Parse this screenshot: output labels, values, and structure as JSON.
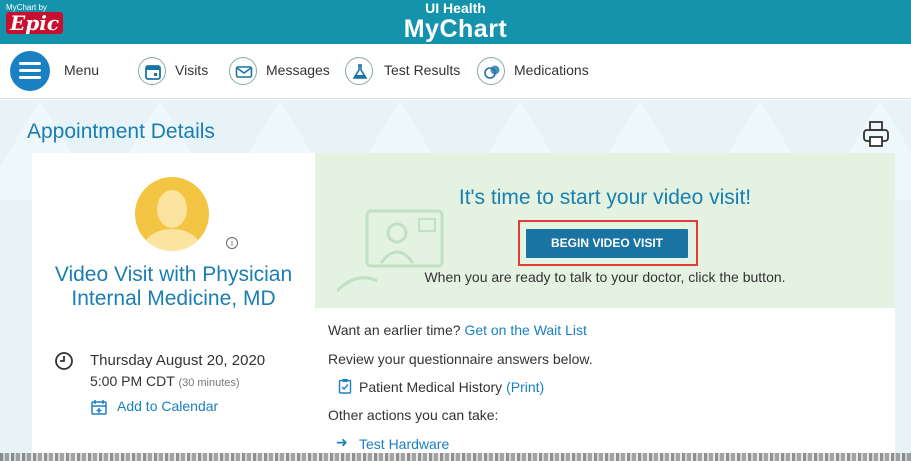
{
  "header": {
    "epic_small": "MyChart by",
    "epic_logo": "Epic",
    "brand_line1": "UI Health",
    "brand_line2": "MyChart"
  },
  "nav": {
    "menu": "Menu",
    "visits": "Visits",
    "messages": "Messages",
    "test_results": "Test Results",
    "medications": "Medications"
  },
  "page": {
    "title": "Appointment Details"
  },
  "left": {
    "visit_title": "Video Visit with Physician Internal Medicine, MD",
    "date": "Thursday August 20, 2020",
    "time": "5:00 PM CDT",
    "duration": "(30 minutes)",
    "add_to_calendar": "Add to Calendar",
    "info": "i"
  },
  "video": {
    "title": "It's time to start your video visit!",
    "button": "BEGIN VIDEO VISIT",
    "hint": "When you are ready to talk to your doctor, click the button."
  },
  "details": {
    "earlier_time": "Want an earlier time?",
    "wait_list_link": "Get on the Wait List",
    "review_text": "Review your questionnaire answers below.",
    "questionnaire": "Patient Medical History",
    "print_link": "(Print)",
    "other_actions": "Other actions you can take:",
    "test_hardware": "Test Hardware"
  },
  "colors": {
    "topbar": "#1593ad",
    "accent_blue": "#1a7fb0",
    "button": "#1a74a3",
    "highlight_outline": "#e33b36",
    "green_panel": "#e4f2e2"
  }
}
